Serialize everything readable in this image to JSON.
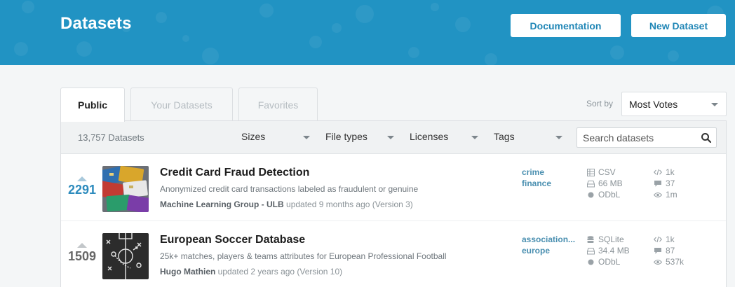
{
  "header": {
    "title": "Datasets",
    "documentation_label": "Documentation",
    "new_dataset_label": "New Dataset"
  },
  "tabs": [
    {
      "label": "Public",
      "active": true
    },
    {
      "label": "Your Datasets"
    },
    {
      "label": "Favorites"
    }
  ],
  "sort": {
    "label": "Sort by",
    "value": "Most Votes"
  },
  "filters": {
    "count": "13,757 Datasets",
    "sizes": "Sizes",
    "file_types": "File types",
    "licenses": "Licenses",
    "tags": "Tags",
    "search_placeholder": "Search datasets"
  },
  "datasets": [
    {
      "votes": "2291",
      "title": "Credit Card Fraud Detection",
      "subtitle": "Anonymized credit card transactions labeled as fraudulent or genuine",
      "owner": "Machine Learning Group - ULB",
      "updated": "updated 9 months ago (Version 3)",
      "tags": [
        "crime",
        "finance"
      ],
      "format": "CSV",
      "size": "66 MB",
      "license": "ODbL",
      "kernels": "1k",
      "comments": "37",
      "views": "1m",
      "thumb_icon": "credit-cards-thumbnail"
    },
    {
      "votes": "1509",
      "title": "European Soccer Database",
      "subtitle": "25k+ matches, players & teams attributes for European Professional Football",
      "owner": "Hugo Mathien",
      "updated": "updated 2 years ago (Version 10)",
      "tags": [
        "association...",
        "europe"
      ],
      "format": "SQLite",
      "size": "34.4 MB",
      "license": "ODbL",
      "kernels": "1k",
      "comments": "87",
      "views": "537k",
      "thumb_icon": "soccer-tactics-thumbnail"
    }
  ],
  "colors": {
    "header_bg": "#2193c3",
    "accent": "#2086b6",
    "tag": "#4a8fb0",
    "vote_active": "#2d8bbd"
  }
}
